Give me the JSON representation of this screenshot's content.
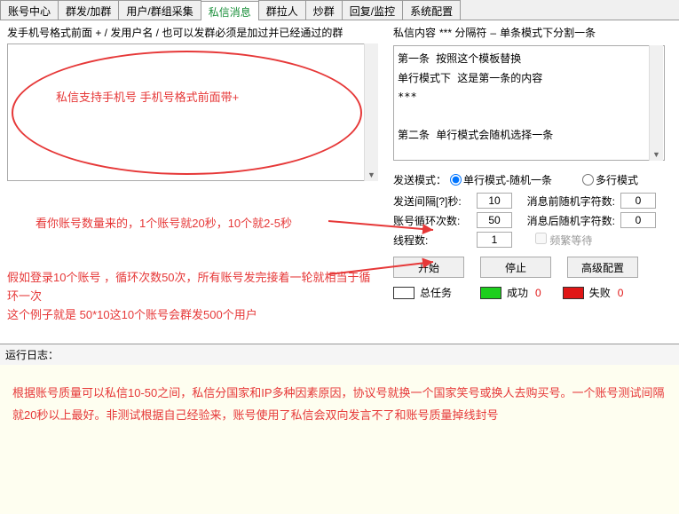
{
  "tabs": {
    "account_center": "账号中心",
    "mass_add": "群发/加群",
    "user_collect": "用户/群组采集",
    "private_msg": "私信消息",
    "group_pull": "群拉人",
    "hype_group": "炒群",
    "reply_monitor": "回复/监控",
    "sys_config": "系统配置"
  },
  "left": {
    "header": "发手机号格式前面 + / 发用户名 / 也可以发群必须是加过并已经通过的群",
    "note1": "私信支持手机号 手机号格式前面带+",
    "note2": "看你账号数量来的，1个账号就20秒，10个就2-5秒",
    "note3_line1": "假如登录10个账号 ，循环次数50次，所有账号发完接着一轮就相当于循环一次",
    "note3_line2": "这个例子就是 50*10这10个账号会群发500个用户"
  },
  "right": {
    "content_label": "私信内容",
    "separator_label": "*** 分隔符",
    "separator_dash": "–",
    "mode_note": "单条模式下分割一条",
    "content_text": "第一条 按照这个模板替换\n单行模式下 这是第一条的内容\n***\n\n第二条 单行模式会随机选择一条",
    "send_mode_label": "发送模式：",
    "mode_single": "单行模式-随机一条",
    "mode_multi": "多行模式",
    "interval_label": "发送间隔[?]秒:",
    "interval_value": "10",
    "prefix_label": "消息前随机字符数:",
    "prefix_value": "0",
    "loop_label": "账号循环次数:",
    "loop_value": "50",
    "suffix_label": "消息后随机字符数:",
    "suffix_value": "0",
    "thread_label": "线程数:",
    "thread_value": "1",
    "freq_wait": "频繁等待",
    "btn_start": "开始",
    "btn_stop": "停止",
    "btn_adv": "高级配置",
    "status_total": "总任务",
    "status_success": "成功",
    "status_success_count": "0",
    "status_fail": "失败",
    "status_fail_count": "0"
  },
  "log": {
    "label": "运行日志："
  },
  "bottom": {
    "text": "根据账号质量可以私信10-50之间，私信分国家和IP多种因素原因，协议号就换一个国家笑号或换人去购买号。一个账号测试间隔就20秒以上最好。非测试根据自己经验来，账号使用了私信会双向发言不了和账号质量掉线封号"
  }
}
